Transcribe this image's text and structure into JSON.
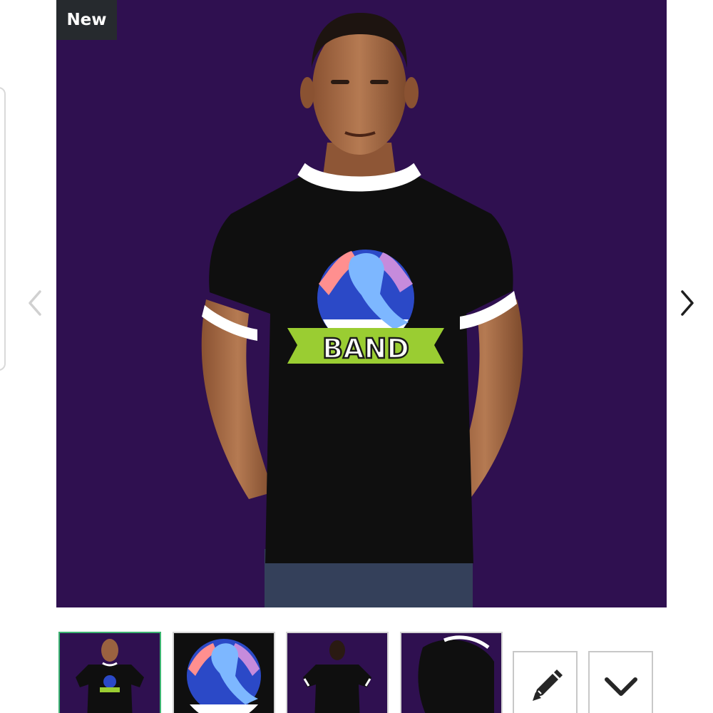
{
  "product": {
    "badge": "New",
    "logo_text": "BAND",
    "colors": {
      "background": "#2f1050",
      "shirt": "#0f0f0f",
      "ringer_trim": "#ffffff",
      "badge_bg": "#262a2e",
      "selected_thumb_border": "#3cb371"
    }
  },
  "carousel": {
    "prev_icon": "chevron-left-icon",
    "next_icon": "chevron-right-icon"
  },
  "thumbnails": [
    {
      "view": "front-model",
      "selected": true
    },
    {
      "view": "design-closeup",
      "selected": false
    },
    {
      "view": "back-model",
      "selected": false
    },
    {
      "view": "sleeve-detail",
      "selected": false
    }
  ],
  "actions": [
    {
      "icon": "pencil-icon"
    },
    {
      "icon": "chevron-down-icon"
    }
  ]
}
